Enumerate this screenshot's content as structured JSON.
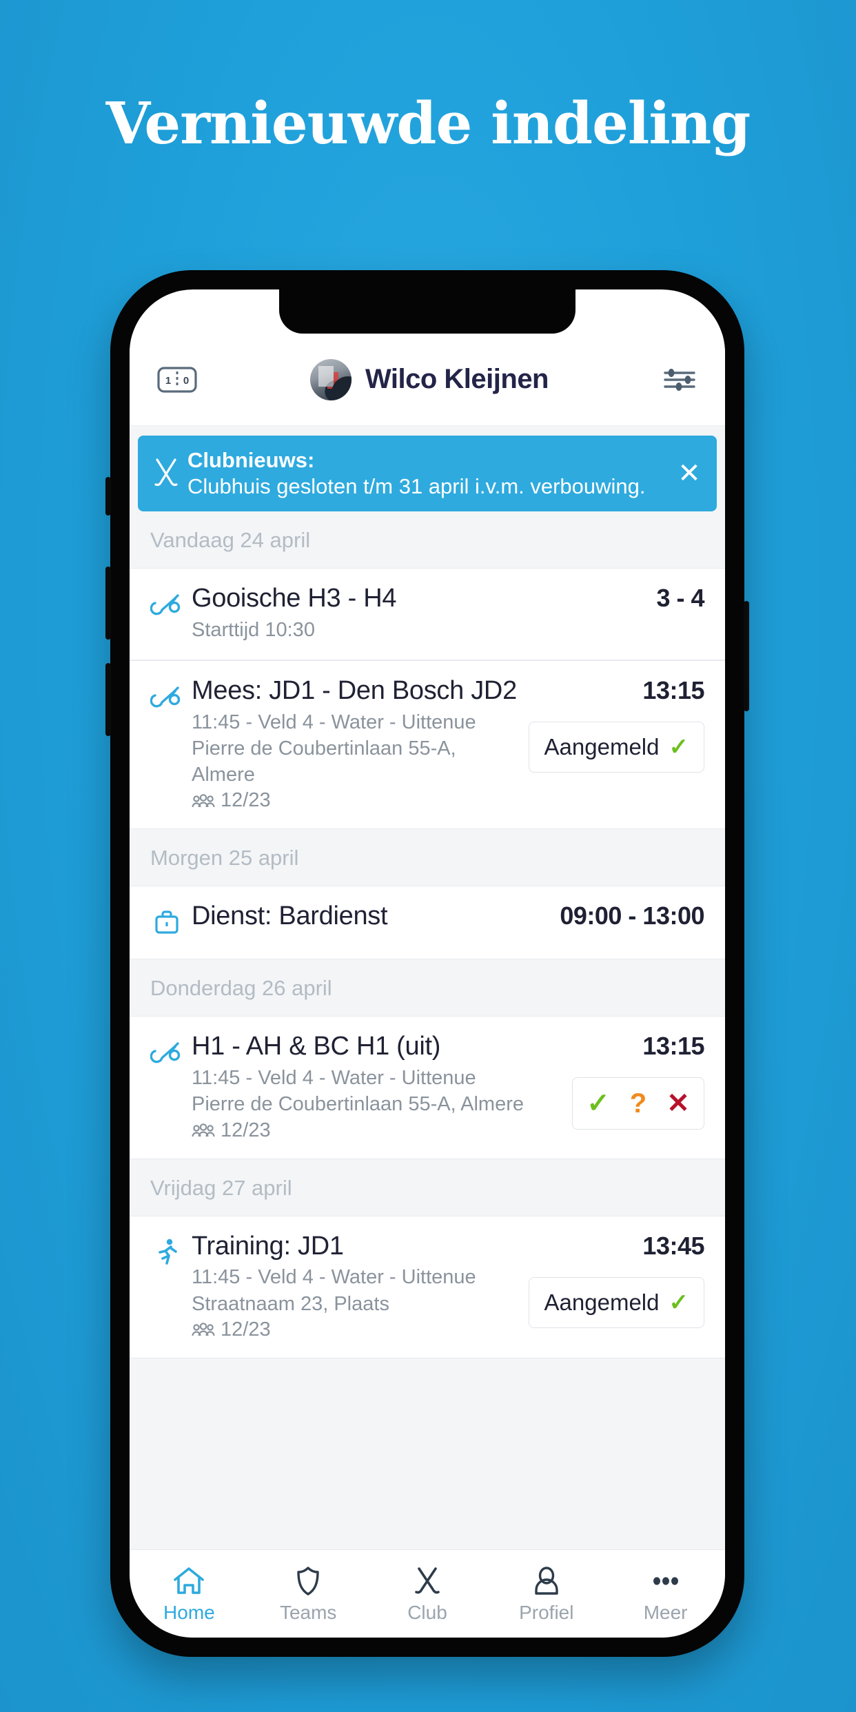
{
  "headline": "Vernieuwde indeling",
  "app": {
    "header": {
      "score_icon": "scoreboard-icon",
      "score_home": "1",
      "score_away": "0",
      "user_name": "Wilco Kleijnen",
      "filter_icon": "sliders-icon"
    },
    "banner": {
      "icon": "hockey-sticks-icon",
      "title": "Clubnieuws:",
      "subtitle": "Clubhuis gesloten t/m 31 april i.v.m. verbouwing.",
      "close_label": "✕",
      "color": "#2eaade"
    },
    "sections": [
      {
        "day": "Vandaag 24 april",
        "events": [
          {
            "icon": "hockey-stick-ball-icon",
            "title": "Gooische H3 - H4",
            "lines": [
              "Starttijd 10:30"
            ],
            "people": null,
            "right_value": "3 - 4",
            "right_type": "score",
            "action": null
          },
          {
            "icon": "hockey-stick-ball-icon",
            "title": "Mees: JD1 - Den Bosch JD2",
            "lines": [
              "11:45 - Veld 4 - Water - Uittenue",
              "Pierre de Coubertinlaan 55-A, Almere"
            ],
            "people": "12/23",
            "right_value": "13:15",
            "right_type": "time",
            "action": {
              "type": "badge",
              "label": "Aangemeld",
              "tick": "✓"
            }
          }
        ]
      },
      {
        "day": "Morgen 25 april",
        "events": [
          {
            "icon": "briefcase-icon",
            "title": "Dienst: Bardienst",
            "lines": [],
            "people": null,
            "right_value": "09:00 - 13:00",
            "right_type": "time",
            "action": null
          }
        ]
      },
      {
        "day": "Donderdag 26 april",
        "events": [
          {
            "icon": "hockey-stick-ball-icon",
            "title": "H1 - AH & BC H1 (uit)",
            "lines": [
              "11:45 - Veld 4 - Water - Uittenue",
              "Pierre de Coubertinlaan 55-A, Almere"
            ],
            "people": "12/23",
            "right_value": "13:15",
            "right_type": "time",
            "action": {
              "type": "rsvp",
              "yes": "✓",
              "maybe": "?",
              "no": "✕"
            }
          }
        ]
      },
      {
        "day": "Vrijdag 27 april",
        "events": [
          {
            "icon": "running-person-icon",
            "title": "Training: JD1",
            "lines": [
              "11:45 - Veld 4 - Water - Uittenue",
              "Straatnaam 23, Plaats"
            ],
            "people": "12/23",
            "right_value": "13:45",
            "right_type": "time",
            "action": {
              "type": "badge",
              "label": "Aangemeld",
              "tick": "✓"
            }
          }
        ]
      }
    ],
    "tabbar": [
      {
        "icon": "home-icon",
        "label": "Home",
        "active": true
      },
      {
        "icon": "shield-icon",
        "label": "Teams",
        "active": false
      },
      {
        "icon": "hockey-sticks-icon",
        "label": "Club",
        "active": false
      },
      {
        "icon": "person-icon",
        "label": "Profiel",
        "active": false
      },
      {
        "icon": "ellipsis-icon",
        "label": "Meer",
        "active": false
      }
    ]
  },
  "colors": {
    "background": "#1fa0da",
    "accent": "#2eaade",
    "text_dark": "#1f2133",
    "text_muted": "#8a939c",
    "day_header": "#b3bcc4",
    "green": "#6bbf1f",
    "orange": "#f08a1e",
    "red": "#b8112b"
  }
}
